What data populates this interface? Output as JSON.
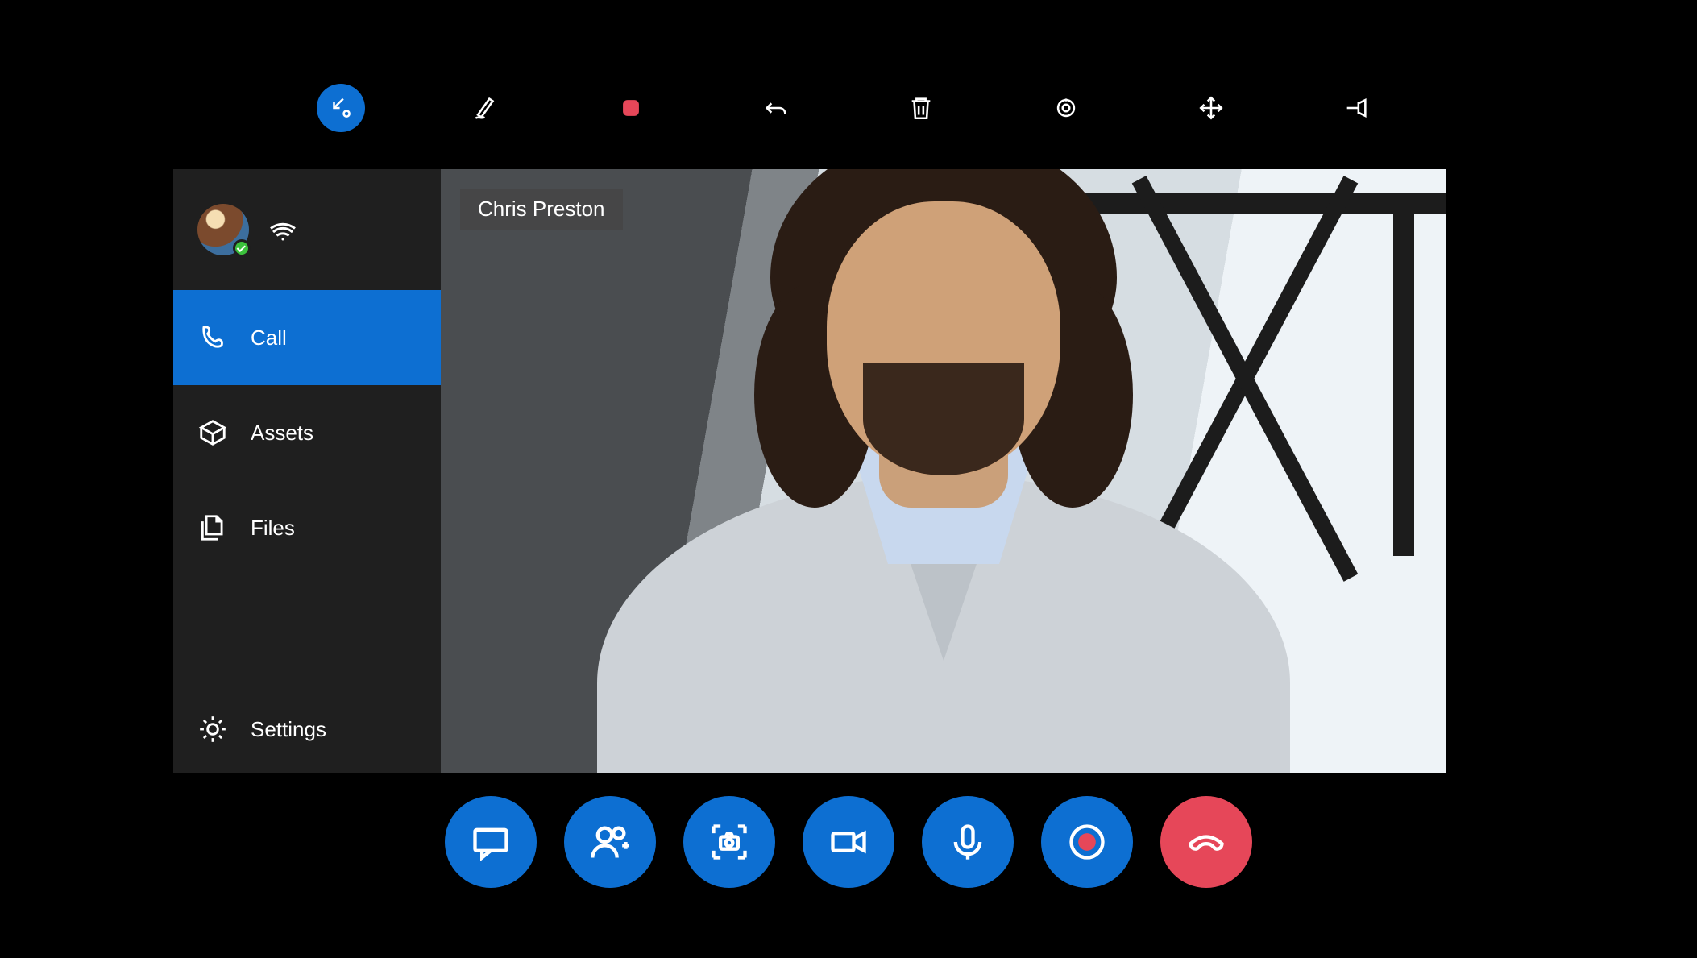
{
  "top_toolbar": {
    "items": [
      {
        "name": "collapse",
        "active": true
      },
      {
        "name": "ink"
      },
      {
        "name": "stop"
      },
      {
        "name": "undo"
      },
      {
        "name": "delete"
      },
      {
        "name": "camera-focus"
      },
      {
        "name": "move"
      },
      {
        "name": "pin"
      }
    ]
  },
  "sidebar": {
    "presence": "available",
    "items": [
      {
        "icon": "phone",
        "label": "Call",
        "active": true
      },
      {
        "icon": "assets",
        "label": "Assets"
      },
      {
        "icon": "files",
        "label": "Files"
      }
    ],
    "settings_label": "Settings"
  },
  "video": {
    "participant_name": "Chris Preston"
  },
  "call_controls": {
    "items": [
      {
        "name": "chat"
      },
      {
        "name": "add-participant"
      },
      {
        "name": "capture"
      },
      {
        "name": "video"
      },
      {
        "name": "mic"
      },
      {
        "name": "record"
      },
      {
        "name": "end-call"
      }
    ]
  },
  "colors": {
    "accent": "#0d6fd2",
    "danger": "#e64759"
  }
}
